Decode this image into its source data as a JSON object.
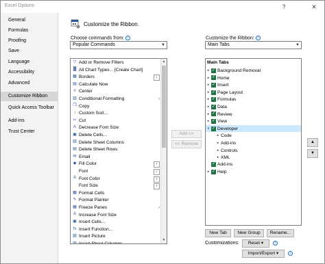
{
  "window": {
    "title": "Excel Options",
    "help": "?",
    "close": "✕"
  },
  "sidebar": {
    "items": [
      {
        "label": "General"
      },
      {
        "label": "Formulas"
      },
      {
        "label": "Proofing"
      },
      {
        "label": "Save"
      },
      {
        "label": "Language"
      },
      {
        "label": "Accessibility"
      },
      {
        "label": "Advanced"
      },
      {
        "label": "Customize Ribbon",
        "active": true
      },
      {
        "label": "Quick Access Toolbar"
      },
      {
        "label": "Add-ins"
      },
      {
        "label": "Trust Center"
      }
    ]
  },
  "main": {
    "heading": "Customize the Ribbon.",
    "choose_label": "Choose commands from:",
    "choose_value": "Popular Commands",
    "customize_label": "Customize the Ribbon:",
    "customize_value": "Main Tabs",
    "add_button": "Add >>",
    "remove_button": "<< Remove",
    "new_tab": "New Tab",
    "new_group": "New Group",
    "rename": "Rename...",
    "customizations_label": "Customizations:",
    "reset": "Reset ▾",
    "import_export": "Import/Export ▾"
  },
  "commands": [
    {
      "label": "Add or Remove Filters",
      "icon": "▽"
    },
    {
      "label": "All Chart Types... [Create Chart]",
      "icon": "▓"
    },
    {
      "label": "Borders",
      "icon": "▦",
      "sub": "box"
    },
    {
      "label": "Calculate Now",
      "icon": "▤"
    },
    {
      "label": "Center",
      "icon": "≡"
    },
    {
      "label": "Conditional Formatting",
      "icon": "▥",
      "sub": "arrow"
    },
    {
      "label": "Copy",
      "icon": "❐"
    },
    {
      "label": "Custom Sort...",
      "icon": "↕"
    },
    {
      "label": "Cut",
      "icon": "✂"
    },
    {
      "label": "Decrease Font Size",
      "icon": "A"
    },
    {
      "label": "Delete Cells...",
      "icon": "▣"
    },
    {
      "label": "Delete Sheet Columns",
      "icon": "▥"
    },
    {
      "label": "Delete Sheet Rows",
      "icon": "▤"
    },
    {
      "label": "Email",
      "icon": "✉"
    },
    {
      "label": "Fill Color",
      "icon": "◆",
      "sub": "box"
    },
    {
      "label": "Font",
      "icon": "",
      "sub": "box"
    },
    {
      "label": "Font Color",
      "icon": "A",
      "sub": "box"
    },
    {
      "label": "Font Size",
      "icon": "",
      "sub": "box"
    },
    {
      "label": "Format Cells",
      "icon": "▦"
    },
    {
      "label": "Format Painter",
      "icon": "✎"
    },
    {
      "label": "Freeze Panes",
      "icon": "▦",
      "sub": "arrow"
    },
    {
      "label": "Increase Font Size",
      "icon": "A"
    },
    {
      "label": "Insert Cells...",
      "icon": "▣"
    },
    {
      "label": "Insert Function...",
      "icon": "fx"
    },
    {
      "label": "Insert Picture",
      "icon": "▧"
    },
    {
      "label": "Insert Sheet Columns",
      "icon": "▥"
    }
  ],
  "tabs": {
    "header": "Main Tabs",
    "rows": [
      {
        "label": "Background Removal",
        "level": 0,
        "expander": "▸",
        "checked": true
      },
      {
        "label": "Home",
        "level": 0,
        "expander": "▸",
        "checked": true
      },
      {
        "label": "Insert",
        "level": 0,
        "expander": "▸",
        "checked": true
      },
      {
        "label": "Page Layout",
        "level": 0,
        "expander": "▸",
        "checked": true
      },
      {
        "label": "Formulas",
        "level": 0,
        "expander": "▸",
        "checked": true
      },
      {
        "label": "Data",
        "level": 0,
        "expander": "▸",
        "checked": true
      },
      {
        "label": "Review",
        "level": 0,
        "expander": "▸",
        "checked": true
      },
      {
        "label": "View",
        "level": 0,
        "expander": "▸",
        "checked": true
      },
      {
        "label": "Developer",
        "level": 0,
        "expander": "∨",
        "checked": true,
        "selected": true
      },
      {
        "label": "Code",
        "level": 1,
        "expander": "▸",
        "checked": false
      },
      {
        "label": "Add-ins",
        "level": 1,
        "expander": "▸",
        "checked": false
      },
      {
        "label": "Controls",
        "level": 1,
        "expander": "▸",
        "checked": false
      },
      {
        "label": "XML",
        "level": 1,
        "expander": "▸",
        "checked": false
      },
      {
        "label": "Add-ins",
        "level": 0,
        "expander": "",
        "checked": true
      },
      {
        "label": "Help",
        "level": 0,
        "expander": "▸",
        "checked": true
      }
    ]
  },
  "move": {
    "up": "▲",
    "down": "▼"
  }
}
